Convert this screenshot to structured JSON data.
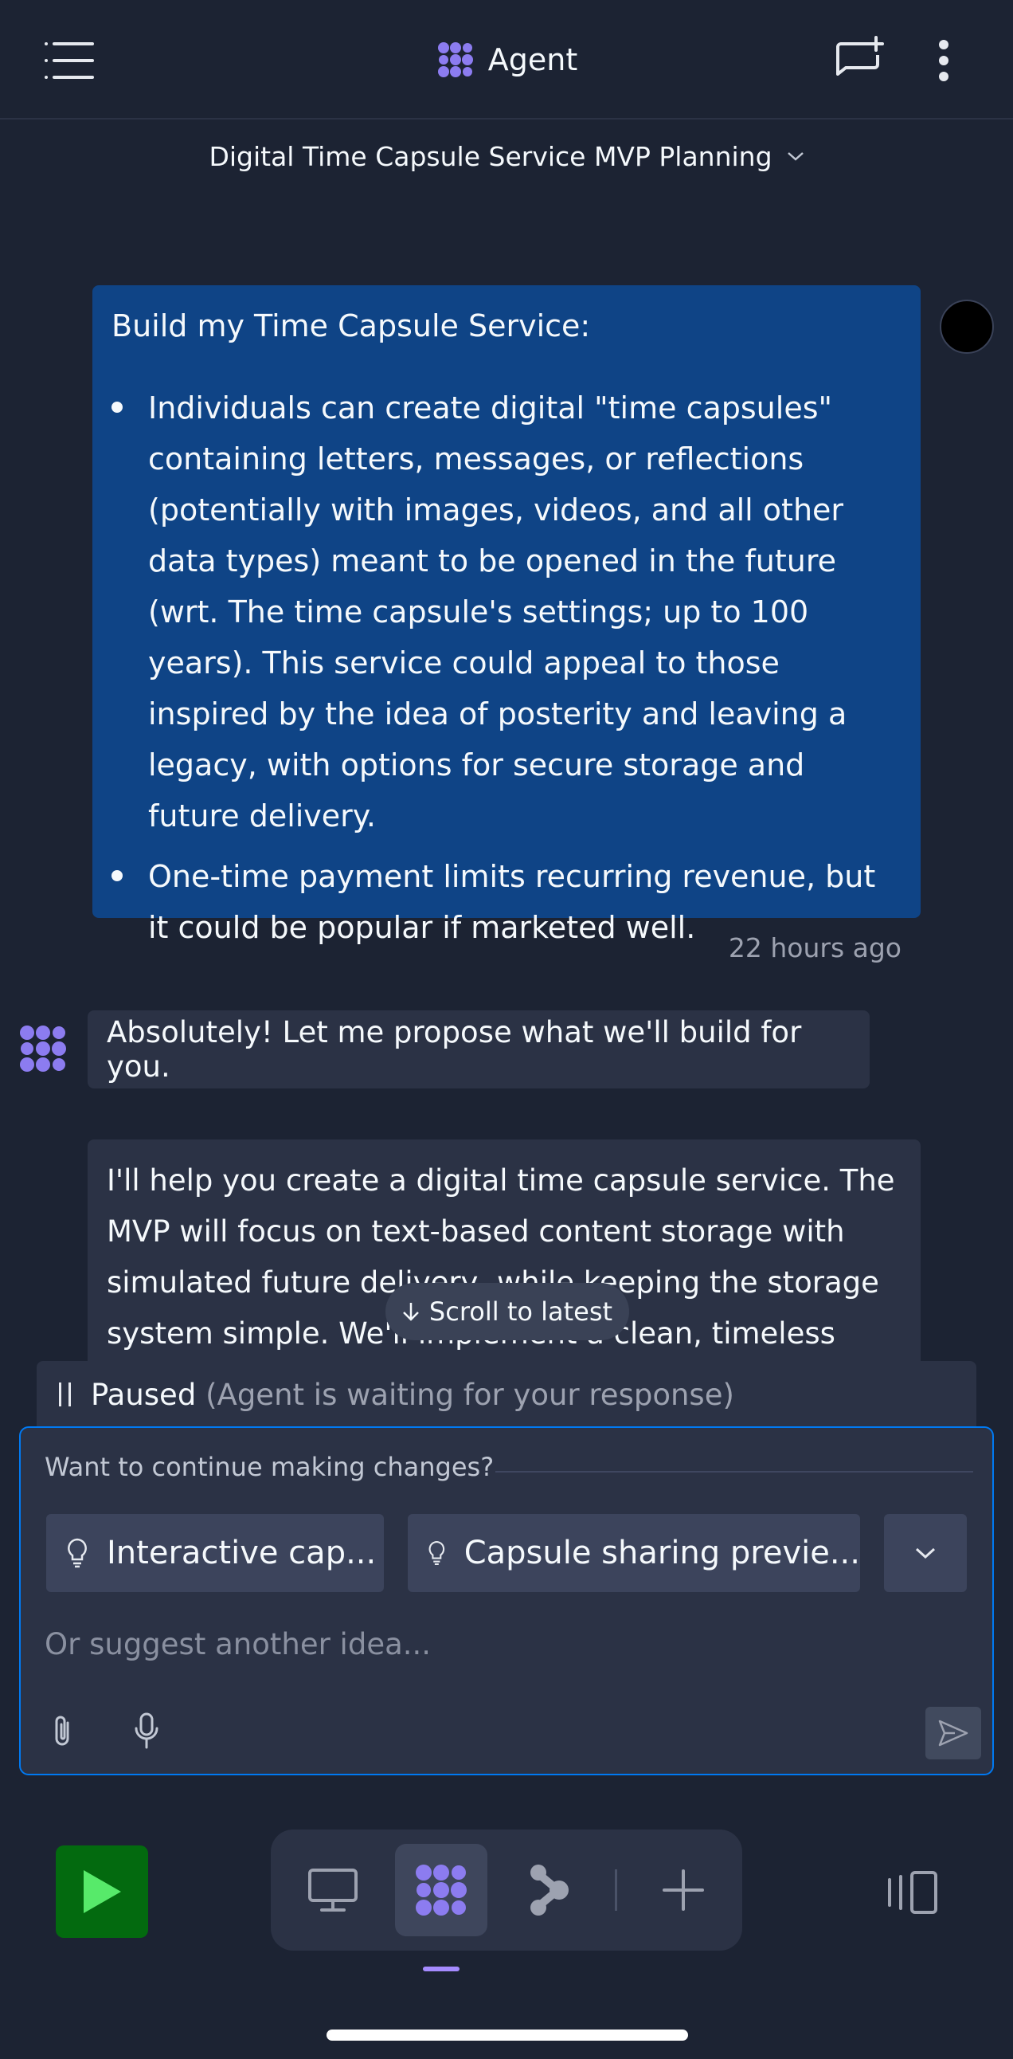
{
  "header": {
    "title": "Agent",
    "chat_title": "Digital Time Capsule Service MVP Planning"
  },
  "user_message": {
    "intro": "Build my Time Capsule Service:",
    "bullets": [
      "Individuals can create digital \"time capsules\" containing letters, messages, or reflections (potentially with images, videos, and all other data types) meant to be opened in the future (wrt. The time capsule's settings; up to 100 years). This service could appeal to those inspired by the idea of posterity and leaving a legacy, with options for secure storage and future delivery.",
      "One-time payment limits recurring revenue, but it could be popular if marketed well."
    ],
    "timestamp": "22 hours ago"
  },
  "agent_messages": {
    "first": "Absolutely! Let me propose what we'll build for you.",
    "second": "I'll help you create a digital time capsule service. The MVP will focus on text-based content storage with simulated future delivery, while keeping the storage system simple. We'll implement a clean, timeless"
  },
  "scroll_button": "Scroll to latest",
  "status": {
    "label": "Paused",
    "detail": "(Agent is waiting for your response)"
  },
  "composer": {
    "question": "Want to continue making changes?",
    "suggestions": [
      "Interactive cap...",
      "Capsule sharing previe..."
    ],
    "placeholder": "Or suggest another idea..."
  },
  "colors": {
    "background": "#1c2333",
    "user_bubble": "#0f4486",
    "agent_bubble": "#2b3245",
    "accent": "#0079f2",
    "agent_purple": "#8c7cf0",
    "run_green": "#036a0f"
  },
  "icons": [
    "menu-icon",
    "agent-logo-icon",
    "new-chat-icon",
    "more-icon",
    "chevron-down-icon",
    "arrow-down-icon",
    "pause-icon",
    "lightbulb-icon",
    "paperclip-icon",
    "microphone-icon",
    "send-icon",
    "play-icon",
    "desktop-icon",
    "workflow-icon",
    "plus-icon",
    "panel-icon"
  ]
}
